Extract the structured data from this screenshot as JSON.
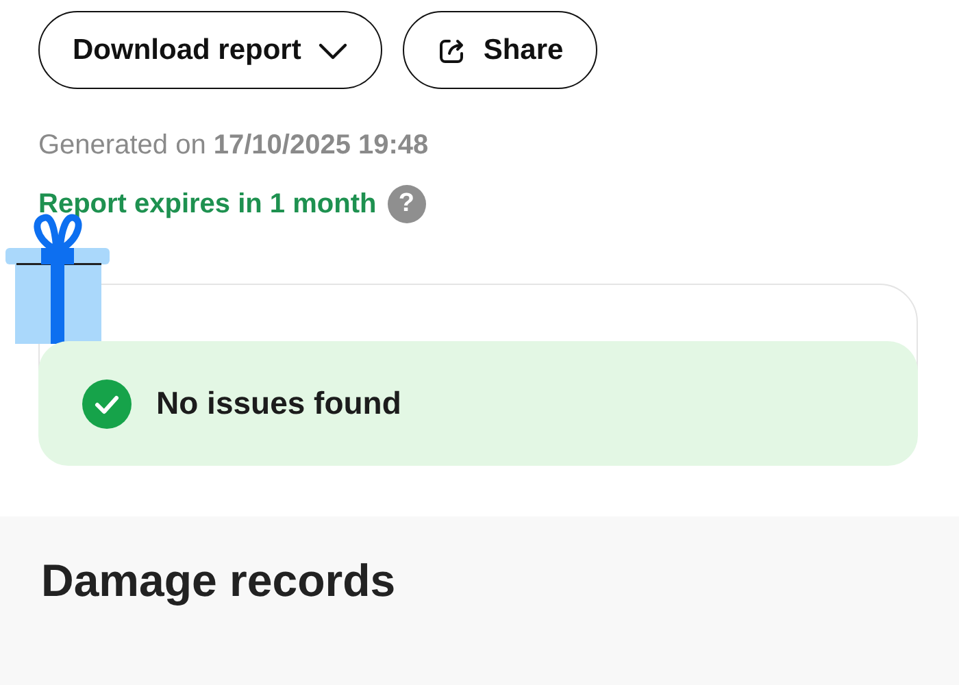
{
  "actions": [
    {
      "kind": "dropdown",
      "label": "Download report"
    },
    {
      "kind": "share",
      "label": "Share"
    }
  ],
  "generated": {
    "label": "Generated on",
    "value": "17/10/2025 19:48"
  },
  "expiry": {
    "text": "Report expires in 1 month",
    "help": "?"
  },
  "status": {
    "kind": "ok",
    "text": "No issues found"
  },
  "section": {
    "title": "Damage records"
  }
}
